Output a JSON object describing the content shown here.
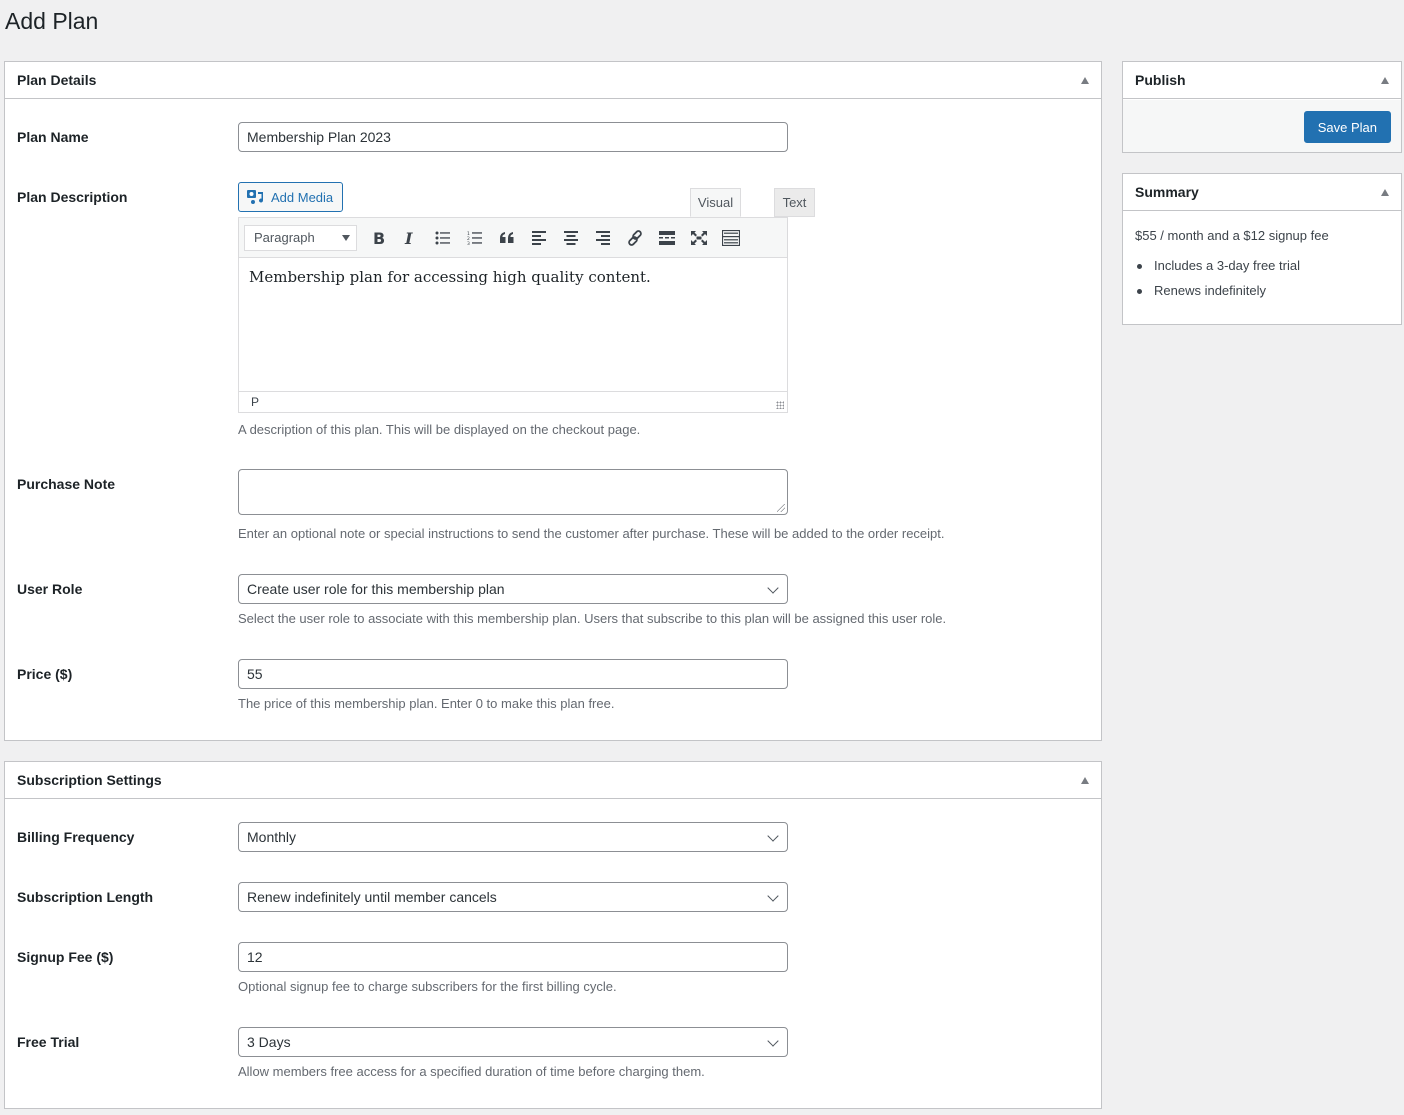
{
  "page": {
    "title": "Add Plan"
  },
  "plan_details": {
    "title": "Plan Details",
    "plan_name": {
      "label": "Plan Name",
      "value": "Membership Plan 2023"
    },
    "plan_description": {
      "label": "Plan Description",
      "add_media_label": "Add Media",
      "tabs": [
        "Visual",
        "Text"
      ],
      "active_tab": "Visual",
      "format_select": "Paragraph",
      "toolbar_icons": [
        "bold-icon",
        "italic-icon",
        "bullet-list-icon",
        "numbered-list-icon",
        "blockquote-icon",
        "align-left-icon",
        "align-center-icon",
        "align-right-icon",
        "link-icon",
        "read-more-icon",
        "fullscreen-icon",
        "toolbar-toggle-icon"
      ],
      "content": "Membership plan for accessing high quality content.",
      "status_path": "P",
      "help": "A description of this plan. This will be displayed on the checkout page."
    },
    "purchase_note": {
      "label": "Purchase Note",
      "value": "",
      "help": "Enter an optional note or special instructions to send the customer after purchase. These will be added to the order receipt."
    },
    "user_role": {
      "label": "User Role",
      "value": "Create user role for this membership plan",
      "help": "Select the user role to associate with this membership plan. Users that subscribe to this plan will be assigned this user role."
    },
    "price": {
      "label": "Price ($)",
      "value": "55",
      "help": "The price of this membership plan. Enter 0 to make this plan free."
    }
  },
  "subscription_settings": {
    "title": "Subscription Settings",
    "billing_frequency": {
      "label": "Billing Frequency",
      "value": "Monthly"
    },
    "subscription_length": {
      "label": "Subscription Length",
      "value": "Renew indefinitely until member cancels"
    },
    "signup_fee": {
      "label": "Signup Fee ($)",
      "value": "12",
      "help": "Optional signup fee to charge subscribers for the first billing cycle."
    },
    "free_trial": {
      "label": "Free Trial",
      "value": "3 Days",
      "help": "Allow members free access for a specified duration of time before charging them."
    }
  },
  "publish": {
    "title": "Publish",
    "save_label": "Save Plan"
  },
  "summary": {
    "title": "Summary",
    "text": "$55 / month and a $12 signup fee",
    "items": [
      "Includes a 3-day free trial",
      "Renews indefinitely"
    ]
  },
  "colors": {
    "primary": "#2271b1",
    "background": "#f0f0f1",
    "border": "#c3c4c7"
  }
}
